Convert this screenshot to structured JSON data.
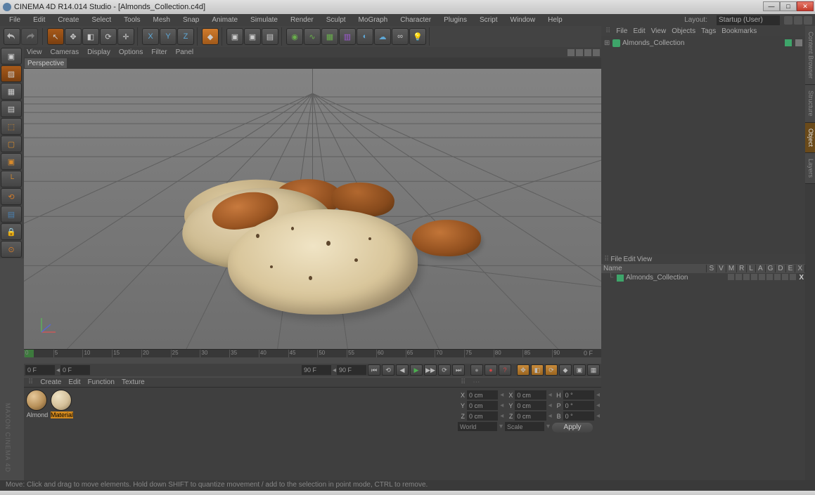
{
  "title_bar": {
    "app_title": "CINEMA 4D R14.014 Studio - [Almonds_Collection.c4d]"
  },
  "menu_bar": {
    "items": [
      "File",
      "Edit",
      "Create",
      "Select",
      "Tools",
      "Mesh",
      "Snap",
      "Animate",
      "Simulate",
      "Render",
      "Sculpt",
      "MoGraph",
      "Character",
      "Plugins",
      "Script",
      "Window",
      "Help"
    ],
    "layout_label": "Layout:",
    "layout_value": "Startup (User)"
  },
  "viewport": {
    "menu": [
      "View",
      "Cameras",
      "Display",
      "Options",
      "Filter",
      "Panel"
    ],
    "perspective_label": "Perspective"
  },
  "timeline": {
    "ticks": [
      "0",
      "5",
      "10",
      "15",
      "20",
      "25",
      "30",
      "35",
      "40",
      "45",
      "50",
      "55",
      "60",
      "65",
      "70",
      "75",
      "80",
      "85",
      "90"
    ],
    "end_label": "0 F"
  },
  "playback": {
    "start": "0 F",
    "cur": "0 F",
    "end_a": "90 F",
    "end_b": "90 F"
  },
  "materials": {
    "menu": [
      "Create",
      "Edit",
      "Function",
      "Texture"
    ],
    "items": [
      {
        "name": "Almond"
      },
      {
        "name": "Material"
      }
    ]
  },
  "coords": {
    "rows": [
      {
        "a": "X",
        "av": "0 cm",
        "b": "X",
        "bv": "0 cm",
        "c": "H",
        "cv": "0 °"
      },
      {
        "a": "Y",
        "av": "0 cm",
        "b": "Y",
        "bv": "0 cm",
        "c": "P",
        "cv": "0 °"
      },
      {
        "a": "Z",
        "av": "0 cm",
        "b": "Z",
        "bv": "0 cm",
        "c": "B",
        "cv": "0 °"
      }
    ],
    "combo_a": "World",
    "combo_b": "Scale",
    "apply": "Apply"
  },
  "obj_mgr": {
    "menu": [
      "File",
      "Edit",
      "View",
      "Objects",
      "Tags",
      "Bookmarks"
    ],
    "root": "Almonds_Collection"
  },
  "attr_mgr": {
    "menu": [
      "File",
      "Edit",
      "View"
    ],
    "columns": [
      "Name",
      "",
      "S",
      "V",
      "M",
      "R",
      "L",
      "A",
      "G",
      "D",
      "E",
      "X"
    ],
    "row_name": "Almonds_Collection"
  },
  "right_tabs": [
    "Content Browser",
    "Structure",
    "Object",
    "Layers"
  ],
  "status": "Move: Click and drag to move elements. Hold down SHIFT to quantize movement / add to the selection in point mode, CTRL to remove.",
  "watermark": "MAXON CINEMA 4D"
}
